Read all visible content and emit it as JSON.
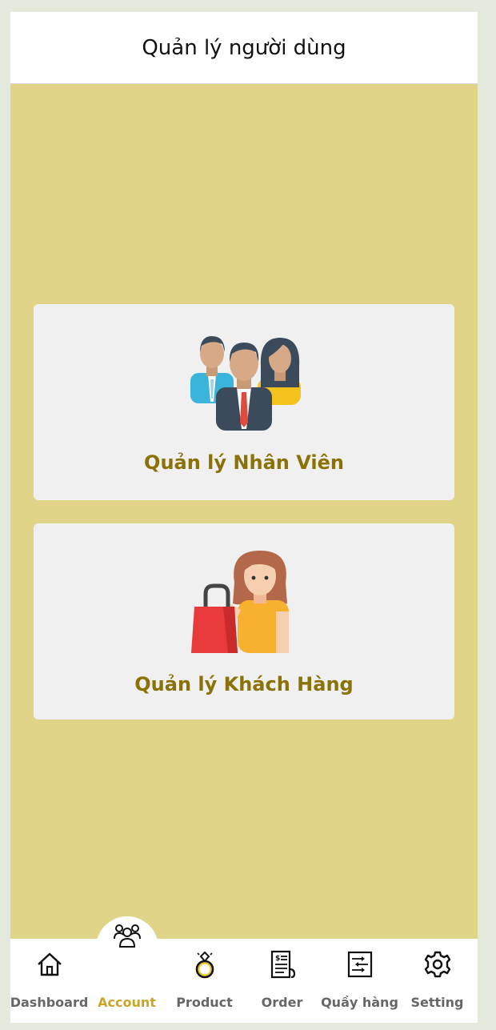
{
  "header": {
    "title": "Quản lý người dùng"
  },
  "cards": {
    "employees": {
      "label": "Quản lý Nhân Viên",
      "icon": "staff-group-icon"
    },
    "customers": {
      "label": "Quản lý Khách Hàng",
      "icon": "shopper-icon"
    }
  },
  "nav": {
    "items": [
      {
        "label": "Dashboard",
        "icon": "home-icon"
      },
      {
        "label": "Account",
        "icon": "users-icon",
        "active": true
      },
      {
        "label": "Product",
        "icon": "ring-icon"
      },
      {
        "label": "Order",
        "icon": "receipt-icon"
      },
      {
        "label": "Quầy hàng",
        "icon": "counter-icon"
      },
      {
        "label": "Setting",
        "icon": "gear-icon"
      }
    ]
  },
  "colors": {
    "background": "#e0d488",
    "card": "#f0f0f0",
    "card_label": "#8a7206",
    "nav_active": "#c9a526",
    "nav_inactive": "#666666"
  }
}
